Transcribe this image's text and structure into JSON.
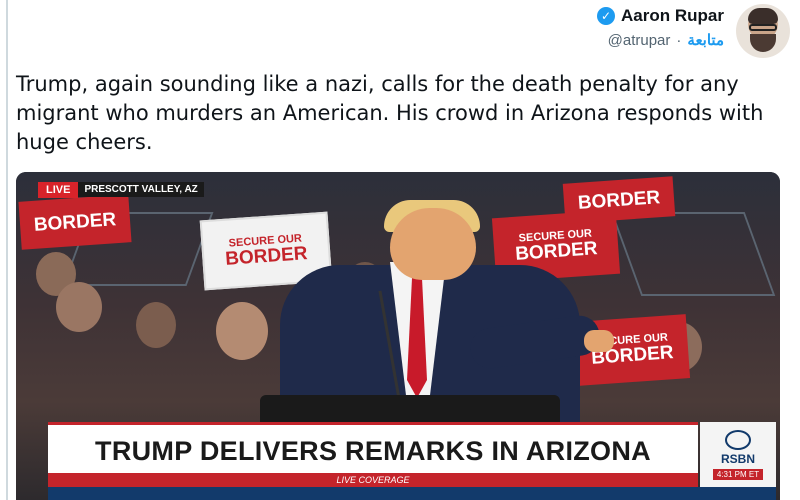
{
  "author": {
    "display_name": "Aaron Rupar",
    "handle": "@atrupar",
    "separator": "·",
    "follow_label": "متابعة",
    "verified_icon": "verified-badge-icon",
    "accent_color": "#1d9bf0"
  },
  "tweet": {
    "text": "Trump, again sounding like a nazi, calls for the death penalty for any migrant who murders an American. His crowd in Arizona responds with huge cheers."
  },
  "media": {
    "live_label": "LIVE",
    "location": "PRESCOTT VALLEY, AZ",
    "sign_text_top": "SECURE OUR",
    "sign_text_bottom": "BORDER",
    "banner_headline": "TRUMP DELIVERS REMARKS IN ARIZONA",
    "sub_banner": "LIVE COVERAGE",
    "ticker": "",
    "network_logo": "RSBN",
    "logo_time": "4:31 PM ET",
    "brand_red": "#c4242b",
    "brand_navy": "#123a6b"
  }
}
